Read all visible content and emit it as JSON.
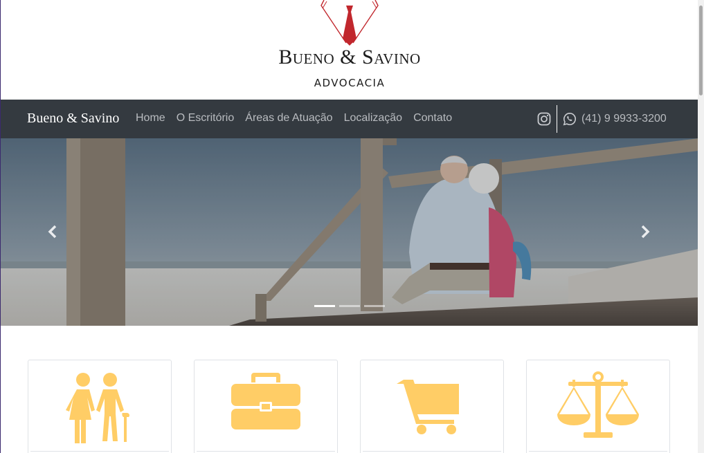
{
  "logo": {
    "title": "Bueno & Savino",
    "subtitle": "ADVOCACIA",
    "tie_color": "#c1272d"
  },
  "navbar": {
    "brand": "Bueno & Savino",
    "links": [
      "Home",
      "O Escritório",
      "Áreas de Atuação",
      "Localização",
      "Contato"
    ],
    "phone": "(41) 9 9933-3200",
    "background": "#343a40"
  },
  "carousel": {
    "slide_count": 3,
    "active_index": 0,
    "prev_icon": "chevron-left-icon",
    "next_icon": "chevron-right-icon"
  },
  "cards": {
    "icon_color": "#ffcd66",
    "items": [
      {
        "icon": "elderly-couple-icon"
      },
      {
        "icon": "briefcase-icon"
      },
      {
        "icon": "shopping-cart-icon"
      },
      {
        "icon": "scales-of-justice-icon"
      }
    ]
  }
}
